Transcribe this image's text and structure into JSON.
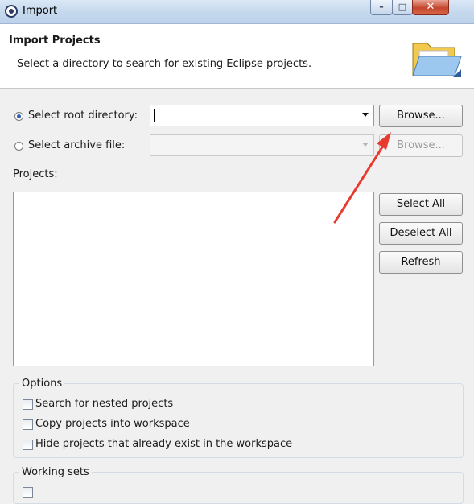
{
  "window": {
    "title": "Import",
    "controls": {
      "minimize": "–",
      "maximize": "□",
      "close": "✕"
    }
  },
  "header": {
    "title": "Import Projects",
    "description": "Select a directory to search for existing Eclipse projects.",
    "icon": "folder-icon"
  },
  "source": {
    "root_directory": {
      "label": "Select root directory:",
      "selected": true,
      "value": "",
      "browse_label": "Browse..."
    },
    "archive_file": {
      "label": "Select archive file:",
      "selected": false,
      "value": "",
      "browse_label": "Browse...",
      "enabled": false
    }
  },
  "projects": {
    "label": "Projects:",
    "items": [],
    "buttons": {
      "select_all": "Select All",
      "deselect_all": "Deselect All",
      "refresh": "Refresh"
    }
  },
  "options": {
    "title": "Options",
    "items": [
      {
        "label": "Search for nested projects",
        "checked": false
      },
      {
        "label": "Copy projects into workspace",
        "checked": false
      },
      {
        "label": "Hide projects that already exist in the workspace",
        "checked": false
      }
    ]
  },
  "working_sets": {
    "title": "Working sets"
  },
  "colors": {
    "annotation_arrow": "#e83a2e",
    "title_bar": "#c6d9ee",
    "close_button": "#c5462c"
  }
}
